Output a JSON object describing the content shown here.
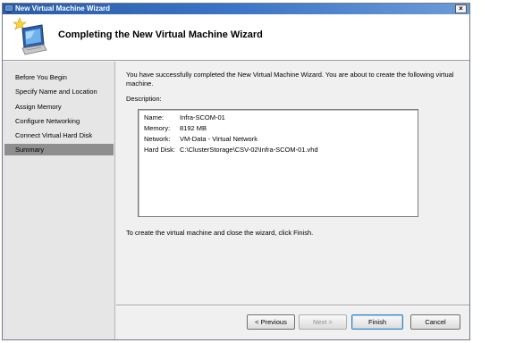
{
  "window": {
    "title": "New Virtual Machine Wizard",
    "close_glyph": "×"
  },
  "header": {
    "title": "Completing the New Virtual Machine Wizard",
    "icon": "wizard-computer-icon"
  },
  "nav": {
    "items": [
      {
        "label": "Before You Begin",
        "selected": false
      },
      {
        "label": "Specify Name and Location",
        "selected": false
      },
      {
        "label": "Assign Memory",
        "selected": false
      },
      {
        "label": "Configure Networking",
        "selected": false
      },
      {
        "label": "Connect Virtual Hard Disk",
        "selected": false
      },
      {
        "label": "Summary",
        "selected": true
      }
    ]
  },
  "content": {
    "intro": "You have successfully completed the New Virtual Machine Wizard. You are about to create the following virtual machine.",
    "description_label": "Description:",
    "description": [
      {
        "key": "Name:",
        "value": "Infra-SCOM-01"
      },
      {
        "key": "Memory:",
        "value": "8192 MB"
      },
      {
        "key": "Network:",
        "value": "VM-Data - Virtual Network"
      },
      {
        "key": "Hard Disk:",
        "value": "C:\\ClusterStorage\\CSV-02\\Infra-SCOM-01.vhd"
      }
    ],
    "finish_instruction": "To create the virtual machine and close the wizard, click Finish."
  },
  "buttons": {
    "previous": "< Previous",
    "next": "Next >",
    "finish": "Finish",
    "cancel": "Cancel"
  },
  "colors": {
    "titlebar": "#2a5ca8",
    "nav_selected": "#8e8e8e",
    "nav_background": "#e6e6e6"
  }
}
